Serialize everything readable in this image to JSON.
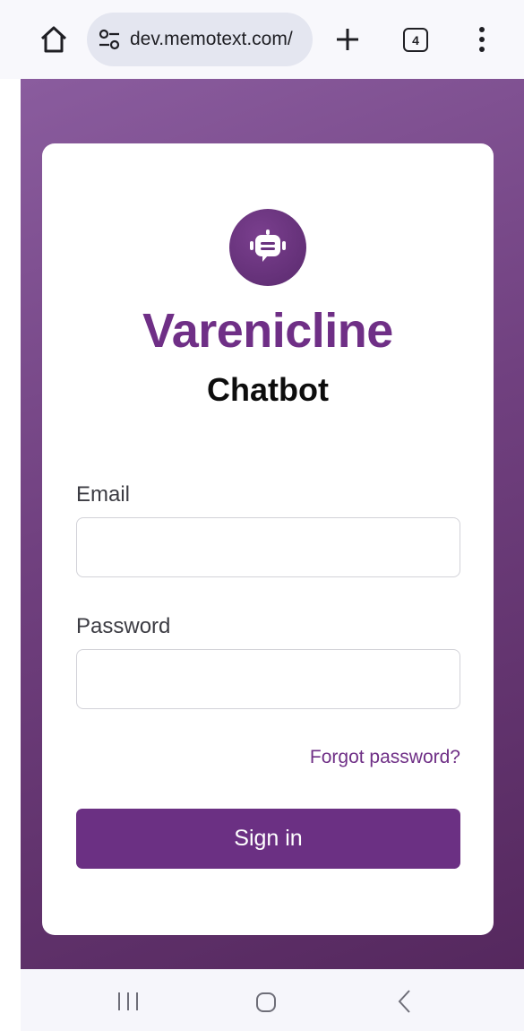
{
  "browser": {
    "url": "dev.memotext.com/",
    "tab_count": "4"
  },
  "login": {
    "brand": "Varenicline",
    "subtitle": "Chatbot",
    "email_label": "Email",
    "email_value": "",
    "password_label": "Password",
    "password_value": "",
    "forgot_label": "Forgot password?",
    "signin_label": "Sign in"
  },
  "colors": {
    "brand_purple": "#6f2f86",
    "button_purple": "#6b3083",
    "background_gradient_start": "#8a5c9e",
    "background_gradient_end": "#55285e"
  },
  "icons": {
    "home": "home-icon",
    "site_settings": "tune-icon",
    "new_tab": "plus-icon",
    "menu": "more-vert-icon",
    "logo": "robot-chat-icon",
    "nav_recents": "recents-icon",
    "nav_home": "nav-home-icon",
    "nav_back": "back-icon"
  }
}
